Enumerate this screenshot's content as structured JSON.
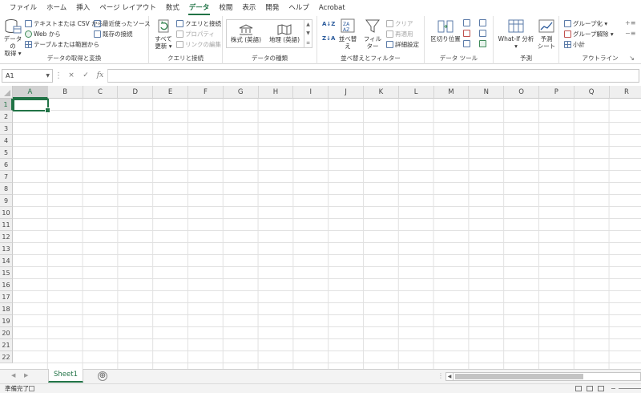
{
  "menu": {
    "tabs": [
      "ファイル",
      "ホーム",
      "挿入",
      "ページ レイアウト",
      "数式",
      "データ",
      "校閲",
      "表示",
      "開発",
      "ヘルプ",
      "Acrobat"
    ],
    "active_index": 5
  },
  "ribbon": {
    "get_data": {
      "big_label_1": "データの",
      "big_label_2": "取得 ▾",
      "text_csv": "テキストまたは CSV から",
      "web": "Web から",
      "table_range": "テーブルまたは範囲から",
      "recent_sources": "最近使ったソース",
      "existing_conn": "既存の接続",
      "group_label": "データの取得と変換"
    },
    "queries": {
      "refresh_1": "すべて",
      "refresh_2": "更新 ▾",
      "queries_conn": "クエリと接続",
      "properties": "プロパティ",
      "edit_links": "リンクの編集",
      "group_label": "クエリと接続"
    },
    "data_types": {
      "stocks": "株式 (英語)",
      "geography": "地理 (英語)",
      "group_label": "データの種類"
    },
    "sort_filter": {
      "sort": "並べ替え",
      "filter": "フィルター",
      "clear": "クリア",
      "reapply": "再適用",
      "advanced": "詳細設定",
      "group_label": "並べ替えとフィルター"
    },
    "tools": {
      "text_to_columns": "区切り位置",
      "group_label": "データ ツール"
    },
    "forecast": {
      "what_if_1": "What-If 分析",
      "what_if_2": "▾",
      "forecast_sheet_1": "予測",
      "forecast_sheet_2": "シート",
      "group_label": "予測"
    },
    "outline": {
      "group": "グループ化 ▾",
      "ungroup": "グループ解除 ▾",
      "subtotal": "小計",
      "group_label": "アウトライン"
    }
  },
  "formula_bar": {
    "name_box": "A1",
    "cancel": "×",
    "enter": "✓",
    "fx": "fx",
    "formula": ""
  },
  "grid": {
    "columns": [
      "A",
      "B",
      "C",
      "D",
      "E",
      "F",
      "G",
      "H",
      "I",
      "J",
      "K",
      "L",
      "M",
      "N",
      "O",
      "P",
      "Q",
      "R"
    ],
    "rows": [
      "1",
      "2",
      "3",
      "4",
      "5",
      "6",
      "7",
      "8",
      "9",
      "10",
      "11",
      "12",
      "13",
      "14",
      "15",
      "16",
      "17",
      "18",
      "19",
      "20",
      "21",
      "22"
    ],
    "active_cell": "A1"
  },
  "sheets": {
    "tabs": [
      "Sheet1"
    ],
    "add": "⊕"
  },
  "status": {
    "text": "準備完了"
  },
  "colors": {
    "accent": "#217346"
  }
}
